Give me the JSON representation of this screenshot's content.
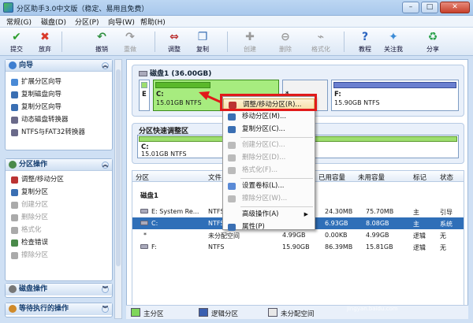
{
  "window": {
    "title": "分区助手3.0中文版（稳定、易用且免费）",
    "min": "–",
    "max": "□",
    "close": "✕"
  },
  "menu": [
    "常规(G)",
    "磁盘(D)",
    "分区(P)",
    "向导(W)",
    "帮助(H)"
  ],
  "toolbar": [
    {
      "label": "提交",
      "icon": "check-icon",
      "color": "#2f9e2f",
      "disabled": false,
      "glyph": "✔"
    },
    {
      "label": "放弃",
      "icon": "cancel-icon",
      "color": "#d93a2a",
      "disabled": false,
      "glyph": "✖"
    },
    {
      "label": "撤销",
      "icon": "undo-icon",
      "color": "#2f8f3f",
      "disabled": false,
      "glyph": "↶"
    },
    {
      "label": "重做",
      "icon": "redo-icon",
      "color": "#9a9a9a",
      "disabled": true,
      "glyph": "↷"
    },
    {
      "label": "调整",
      "icon": "resize-icon",
      "color": "#b33",
      "disabled": false,
      "glyph": "⇔"
    },
    {
      "label": "复制",
      "icon": "copy-icon",
      "color": "#3a6fb3",
      "disabled": false,
      "glyph": "❐"
    },
    {
      "label": "创建",
      "icon": "create-icon",
      "color": "#9a9a9a",
      "disabled": true,
      "glyph": "✚"
    },
    {
      "label": "删除",
      "icon": "delete-icon",
      "color": "#9a9a9a",
      "disabled": true,
      "glyph": "⊖"
    },
    {
      "label": "格式化",
      "icon": "format-icon",
      "color": "#9a9a9a",
      "disabled": true,
      "glyph": "⌁"
    },
    {
      "label": "教程",
      "icon": "help-icon",
      "color": "#2a64c0",
      "disabled": false,
      "glyph": "?"
    },
    {
      "label": "关注我",
      "icon": "follow-icon",
      "color": "#3b8bd6",
      "disabled": false,
      "glyph": "✦"
    },
    {
      "label": "分享",
      "icon": "share-icon",
      "color": "#2aa14a",
      "disabled": false,
      "glyph": "♻"
    }
  ],
  "wizard": {
    "title": "向导",
    "items": [
      {
        "label": "扩展分区向导",
        "color": "#4a8ad6"
      },
      {
        "label": "复制磁盘向导",
        "color": "#3a6fb3"
      },
      {
        "label": "复制分区向导",
        "color": "#3a6fb3"
      },
      {
        "label": "动态磁盘转换器",
        "color": "#6a6a8a"
      },
      {
        "label": "NTFS与FAT32转换器",
        "color": "#6a6a8a"
      }
    ]
  },
  "partition_ops": {
    "title": "分区操作",
    "items": [
      {
        "label": "调整/移动分区",
        "disabled": false,
        "color": "#b33"
      },
      {
        "label": "复制分区",
        "disabled": false,
        "color": "#3a6fb3"
      },
      {
        "label": "创建分区",
        "disabled": true,
        "color": "#aaa"
      },
      {
        "label": "删除分区",
        "disabled": true,
        "color": "#aaa"
      },
      {
        "label": "格式化",
        "disabled": true,
        "color": "#aaa"
      },
      {
        "label": "检查错误",
        "disabled": false,
        "color": "#4a8a4a"
      },
      {
        "label": "擦除分区",
        "disabled": true,
        "color": "#aaa"
      }
    ]
  },
  "disk_ops": {
    "title": "磁盘操作"
  },
  "pending_ops": {
    "title": "等待执行的操作"
  },
  "disk1": {
    "title": "磁盘1 (36.00GB)",
    "parts": [
      {
        "name": "E",
        "info": "",
        "usage": 0.3
      },
      {
        "name": "C:",
        "info": "15.01GB NTFS",
        "usage": 0.45
      },
      {
        "name": "*",
        "info": "",
        "usage": 0
      },
      {
        "name": "F:",
        "info": "15.90GB NTFS",
        "usage": 0.06
      }
    ]
  },
  "quick": {
    "title": "分区快速调整区",
    "name": "C:",
    "info": "15.01GB NTFS"
  },
  "table": {
    "headers": [
      "分区",
      "文件系统",
      "容量",
      "已用容量",
      "未用容量",
      "标记",
      "状态"
    ],
    "disk_label": "磁盘1",
    "rows": [
      {
        "name": "E:  System Re...",
        "fs": "NTFS",
        "cap": "",
        "used": "24.30MB",
        "free": "75.70MB",
        "flag": "主",
        "status": "引导"
      },
      {
        "name": "C:",
        "fs": "NTFS",
        "cap": "",
        "used": "6.93GB",
        "free": "8.08GB",
        "flag": "主",
        "status": "系统"
      },
      {
        "name": "*",
        "fs": "未分配空间",
        "cap": "4.99GB",
        "used": "0.00KB",
        "free": "4.99GB",
        "flag": "逻辑",
        "status": "无"
      },
      {
        "name": "F:",
        "fs": "NTFS",
        "cap": "15.90GB",
        "used": "86.39MB",
        "free": "15.81GB",
        "flag": "逻辑",
        "status": "无"
      }
    ]
  },
  "legend": [
    {
      "label": "主分区",
      "color": "#7fd65a"
    },
    {
      "label": "逻辑分区",
      "color": "#3a5fb0"
    },
    {
      "label": "未分配空间",
      "color": "#e8e8e8"
    }
  ],
  "context_menu": [
    {
      "label": "调整/移动分区(R)...",
      "disabled": false,
      "color": "#b33",
      "highlight": true
    },
    {
      "label": "移动分区(M)...",
      "disabled": false,
      "color": "#3a6fb3"
    },
    {
      "label": "复制分区(C)...",
      "disabled": false,
      "color": "#3a6fb3"
    },
    {
      "label": "创建分区(C)...",
      "disabled": true,
      "color": "#bbb"
    },
    {
      "label": "删除分区(D)...",
      "disabled": true,
      "color": "#bbb"
    },
    {
      "label": "格式化(F)...",
      "disabled": true,
      "color": "#bbb"
    },
    {
      "label": "设置卷标(L)...",
      "disabled": false,
      "color": "#5a8ad6"
    },
    {
      "label": "擦除分区(W)...",
      "disabled": true,
      "color": "#bbb"
    },
    {
      "label": "高级操作(A)",
      "disabled": false,
      "color": "",
      "submenu": "▶"
    },
    {
      "label": "属性(P)",
      "disabled": false,
      "color": "#3a6fb3"
    }
  ],
  "watermark": {
    "line1": "Baidu经验",
    "line2": "jingyan.baidu.com"
  }
}
